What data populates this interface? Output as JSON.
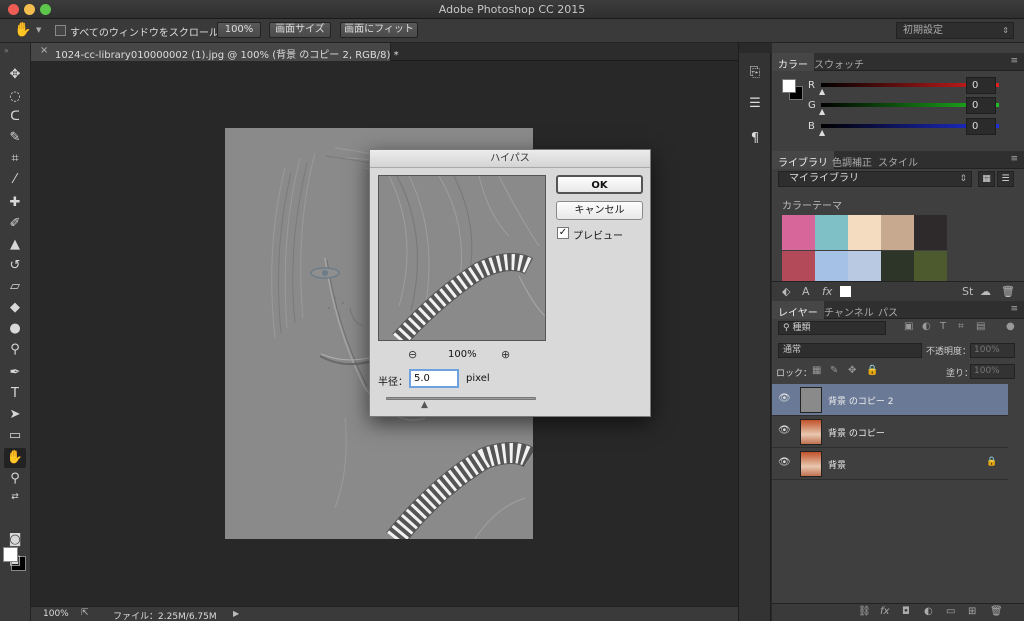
{
  "window": {
    "title": "Adobe Photoshop CC 2015"
  },
  "options_bar": {
    "scroll_all_label": "すべてのウィンドウをスクロール",
    "btn_100": "100%",
    "btn_fit_screen": "画面サイズ",
    "btn_fill_screen": "画面にフィット",
    "workspace_preset": "初期設定"
  },
  "document": {
    "tab_title": "1024-cc-library010000002 (1).jpg @ 100% (背景 のコピー 2, RGB/8) *",
    "close_glyph": "×"
  },
  "status_bar": {
    "zoom": "100%",
    "file_size": "ファイル：2.25M/6.75M"
  },
  "color_panel": {
    "tabs": [
      "カラー",
      "スウォッチ"
    ],
    "channels": [
      {
        "label": "R",
        "value": "0",
        "color": "#e02020"
      },
      {
        "label": "G",
        "value": "0",
        "color": "#20c020"
      },
      {
        "label": "B",
        "value": "0",
        "color": "#2030e0"
      }
    ]
  },
  "libraries_panel": {
    "tabs": [
      "ライブラリ",
      "色調補正",
      "スタイル"
    ],
    "library_name": "マイライブラリ",
    "theme_label": "カラーテーマ",
    "theme_row1": [
      "#d7679a",
      "#7fbfc6",
      "#f3dcc0",
      "#c6a98f",
      "#2e2a2b"
    ],
    "theme_row2": [
      "#b34a5a",
      "#a6c1e6",
      "#b9c9e1",
      "#2d3528",
      "#4c5a2d"
    ]
  },
  "layers_panel": {
    "tabs": [
      "レイヤー",
      "チャンネル",
      "パス"
    ],
    "filter_kind": "種類",
    "blend_mode": "通常",
    "opacity_label": "不透明度：",
    "opacity_value": "100%",
    "lock_label": "ロック：",
    "fill_label": "塗り：",
    "fill_value": "100%",
    "layers": [
      {
        "name": "背景 のコピー 2",
        "selected": true
      },
      {
        "name": "背景 のコピー",
        "selected": false
      },
      {
        "name": "背景",
        "selected": false,
        "locked": true
      }
    ]
  },
  "dialog": {
    "title": "ハイパス",
    "ok": "OK",
    "cancel": "キャンセル",
    "preview_label": "プレビュー",
    "preview_checked": true,
    "zoom": "100%",
    "radius_label": "半径：",
    "radius_value": "5.0",
    "radius_unit": "pixel"
  }
}
